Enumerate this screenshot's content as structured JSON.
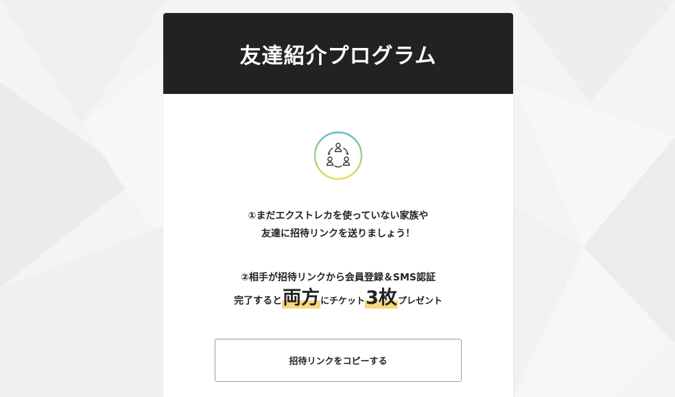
{
  "header": {
    "title": "友達紹介プログラム"
  },
  "icon": {
    "name": "referral-people-icon"
  },
  "step1": {
    "line1": "①まだエクストレカを使っていない家族や",
    "line2": "友達に招待リンクを送りましょう！"
  },
  "step2": {
    "line1": "②相手が招待リンクから会員登録＆SMS認証",
    "line2_prefix": "完了すると",
    "line2_highlight1": "両方",
    "line2_middle": "にチケット",
    "line2_highlight2": "3枚",
    "line2_suffix": "プレゼント"
  },
  "copy_button": {
    "label": "招待リンクをコピーする"
  },
  "colors": {
    "header_bg": "#222222",
    "highlight": "#f7d87c",
    "icon_ring_start": "#5bbcd0",
    "icon_ring_end": "#e6e04f"
  }
}
